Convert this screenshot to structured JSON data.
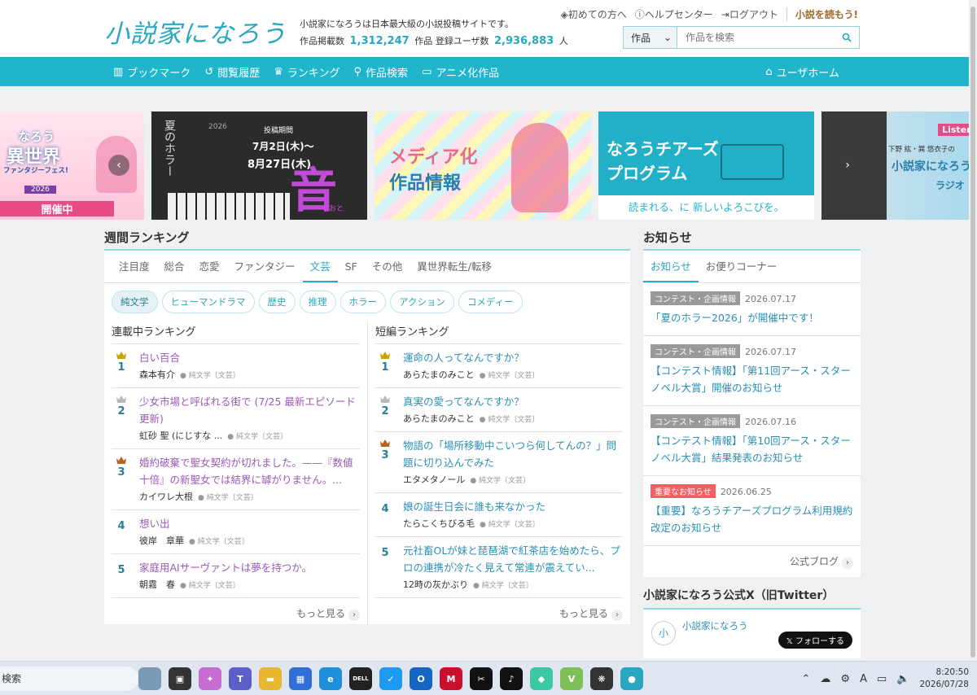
{
  "header": {
    "logo": "小説家になろう",
    "tagline": "小説家になろうは日本最大級の小説投稿サイトです。",
    "stats": {
      "works_label": "作品掲載数",
      "works_count": "1,312,247",
      "works_unit": "作品",
      "users_label": "登録ユーザ数",
      "users_count": "2,936,883",
      "users_unit": "人"
    },
    "links": [
      "初めての方へ",
      "ヘルプセンター",
      "ログアウト"
    ],
    "yomou": "小説を読もう!",
    "search": {
      "select": "作品",
      "placeholder": "作品を検索"
    }
  },
  "nav": {
    "items": [
      "ブックマーク",
      "閲覧履歴",
      "ランキング",
      "作品検索",
      "アニメ化作品"
    ],
    "user_home": "ユーザホーム"
  },
  "banners": {
    "b1": {
      "line1": "なろう",
      "line2": "異世界",
      "line3": "ファンタジーフェス!",
      "year": "2026",
      "status": "開催中"
    },
    "b2": {
      "title": "夏のホラー",
      "year": "2026",
      "period_label": "投稿期間",
      "date_start": "7月2日(木)〜",
      "date_end": "8月27日(木)",
      "kanji": "音",
      "kana": "おと"
    },
    "b3": {
      "line1": "メディア化",
      "line2": "作品情報"
    },
    "b4": {
      "line1": "なろうチアーズ",
      "line2": "プログラム",
      "sub": "読まれる、に 新しいよろこびを。"
    },
    "b5": {
      "listen": "Listen",
      "host": "下野 紘・巽 悠衣子の",
      "title": "小説家になろう",
      "sub": "ラジオ"
    }
  },
  "ranking": {
    "title": "週間ランキング",
    "tabs": [
      "注目度",
      "総合",
      "恋愛",
      "ファンタジー",
      "文芸",
      "SF",
      "その他",
      "異世界転生/転移"
    ],
    "genres": [
      "純文学",
      "ヒューマンドラマ",
      "歴史",
      "推理",
      "ホラー",
      "アクション",
      "コメディー"
    ],
    "serial": {
      "heading": "連載中ランキング",
      "items": [
        {
          "rank": "1",
          "title": "白い百合",
          "author": "森本有介",
          "genre": "純文学〔文芸〕"
        },
        {
          "rank": "2",
          "title": "少女市場と呼ばれる街で (7/25 最新エピソード更新)",
          "author": "虹砂 聖 (にじすな ...",
          "genre": "純文学〔文芸〕"
        },
        {
          "rank": "3",
          "title": "婚約破棄で聖女契約が切れました。——『数値十倍』の新聖女では結界に罅がりません。...",
          "author": "カイワレ大根",
          "genre": "純文学〔文芸〕"
        },
        {
          "rank": "4",
          "title": "想い出",
          "author": "彼岸　章華",
          "genre": "純文学〔文芸〕"
        },
        {
          "rank": "5",
          "title": "家庭用AIサーヴァントは夢を持つか。",
          "author": "朝霧　春",
          "genre": "純文学〔文芸〕"
        }
      ],
      "more": "もっと見る"
    },
    "short": {
      "heading": "短編ランキング",
      "items": [
        {
          "rank": "1",
          "title": "運命の人ってなんですか？",
          "author": "あらたまのみこと",
          "genre": "純文学〔文芸〕"
        },
        {
          "rank": "2",
          "title": "真実の愛ってなんですか？",
          "author": "あらたまのみこと",
          "genre": "純文学〔文芸〕"
        },
        {
          "rank": "3",
          "title": "物語の「場所移動中こいつら何してんの？」問題に切り込んでみた",
          "author": "エタメタノール",
          "genre": "純文学〔文芸〕"
        },
        {
          "rank": "4",
          "title": "娘の誕生日会に誰も来なかった",
          "author": "たらこくちびる毛",
          "genre": "純文学〔文芸〕"
        },
        {
          "rank": "5",
          "title": "元社畜OLが妹と琵琶湖で紅茶店を始めたら、プロの連携が冷たく見えて常連が震えてい...",
          "author": "12時の灰かぶり",
          "genre": "純文学〔文芸〕"
        }
      ],
      "more": "もっと見る"
    }
  },
  "news": {
    "title": "お知らせ",
    "tabs": [
      "お知らせ",
      "お便りコーナー"
    ],
    "items": [
      {
        "badge": "コンテスト・企画情報",
        "date": "2026.07.17",
        "title": "「夏のホラー2026」が開催中です！"
      },
      {
        "badge": "コンテスト・企画情報",
        "date": "2026.07.17",
        "title": "【コンテスト情報】「第11回アース・スターノベル大賞」開催のお知らせ"
      },
      {
        "badge": "コンテスト・企画情報",
        "date": "2026.07.16",
        "title": "【コンテスト情報】「第10回アース・スターノベル大賞」結果発表のお知らせ"
      },
      {
        "badge": "重要なお知らせ",
        "date": "2026.06.25",
        "title": "【重要】なろうチアーズプログラム利用規約改定のお知らせ"
      }
    ],
    "blog": "公式ブログ"
  },
  "x": {
    "title": "小説家になろう公式X（旧Twitter）",
    "avatar": "小",
    "name": "小説家になろう",
    "follow": "フォローする"
  },
  "taskbar": {
    "search": "検索",
    "time": "8:20:50",
    "date": "2026/07/28",
    "ime": "A",
    "apps": [
      {
        "icon": "stadium-icon",
        "color": "#7a9bb5",
        "glyph": ""
      },
      {
        "icon": "task-view-icon",
        "color": "#333333",
        "glyph": "▣"
      },
      {
        "icon": "copilot-icon",
        "color": "#c76cd1",
        "glyph": "✦"
      },
      {
        "icon": "teams-icon",
        "color": "#5b5fc7",
        "glyph": "T"
      },
      {
        "icon": "folder-icon",
        "color": "#e8b730",
        "glyph": "▬"
      },
      {
        "icon": "store-icon",
        "color": "#2f6fd6",
        "glyph": "▦"
      },
      {
        "icon": "edge-icon",
        "color": "#1e8fd8",
        "glyph": "e"
      },
      {
        "icon": "dell-icon",
        "color": "#222222",
        "glyph": "DELL"
      },
      {
        "icon": "twitter-icon",
        "color": "#1d9bf0",
        "glyph": "✓"
      },
      {
        "icon": "outlook-icon",
        "color": "#1466c2",
        "glyph": "O"
      },
      {
        "icon": "mcafee-icon",
        "color": "#c8102e",
        "glyph": "M"
      },
      {
        "icon": "capcut-icon",
        "color": "#111111",
        "glyph": "✂"
      },
      {
        "icon": "tiktok-icon",
        "color": "#111111",
        "glyph": "♪"
      },
      {
        "icon": "app-icon",
        "color": "#3cc8a0",
        "glyph": "◆"
      },
      {
        "icon": "vivaldi-icon",
        "color": "#7fbf5a",
        "glyph": "V"
      },
      {
        "icon": "chatgpt-icon",
        "color": "#333333",
        "glyph": "❋"
      },
      {
        "icon": "app-blue-icon",
        "color": "#2aa7c0",
        "glyph": "●"
      }
    ]
  },
  "colors": {
    "accent": "#21b5cc",
    "link": "#2a8fb5",
    "serial_title": "#9b59b6",
    "badge_important": "#f25f62",
    "gold": "#c9a400",
    "silver": "#b9b9b9",
    "bronze": "#b5651d"
  }
}
